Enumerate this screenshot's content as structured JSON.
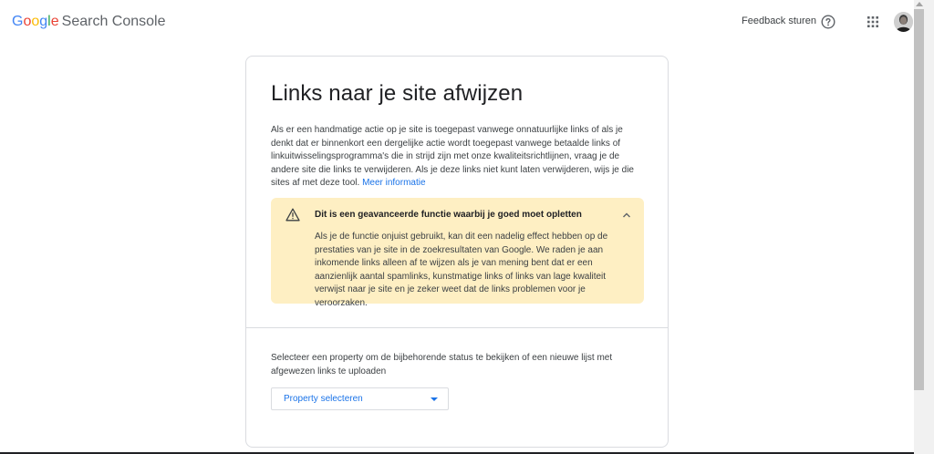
{
  "header": {
    "logo_letters": [
      "G",
      "o",
      "o",
      "g",
      "l",
      "e"
    ],
    "product_name": "Search Console",
    "feedback_label": "Feedback sturen"
  },
  "icons": {
    "help": "help-circle-icon",
    "apps": "apps-grid-icon",
    "avatar": "user-avatar",
    "warning": "warning-triangle-icon",
    "collapse": "chevron-up-icon",
    "dropdown": "caret-down-icon"
  },
  "colors": {
    "accent": "#1a73e8",
    "warning_bg": "#feefc3",
    "border": "#dadce0"
  },
  "page": {
    "title": "Links naar je site afwijzen",
    "description": "Als er een handmatige actie op je site is toegepast vanwege onnatuurlijke links of als je denkt dat er binnenkort een dergelijke actie wordt toegepast vanwege betaalde links of linkuitwisselingsprogramma's die in strijd zijn met onze kwaliteitsrichtlijnen, vraag je de andere site die links te verwijderen. Als je deze links niet kunt laten verwijderen, wijs je die sites af met deze tool. ",
    "more_info_link": "Meer informatie"
  },
  "warning": {
    "title": "Dit is een geavanceerde functie waarbij je goed moet opletten",
    "body": "Als je de functie onjuist gebruikt, kan dit een nadelig effect hebben op de prestaties van je site in de zoekresultaten van Google. We raden je aan inkomende links alleen af te wijzen als je van mening bent dat er een aanzienlijk aantal spamlinks, kunstmatige links of links van lage kwaliteit verwijst naar je site en je zeker weet dat de links problemen voor je veroorzaken."
  },
  "property": {
    "instruction": "Selecteer een property om de bijbehorende status te bekijken of een nieuwe lijst met afgewezen links te uploaden",
    "select_label": "Property selecteren"
  }
}
